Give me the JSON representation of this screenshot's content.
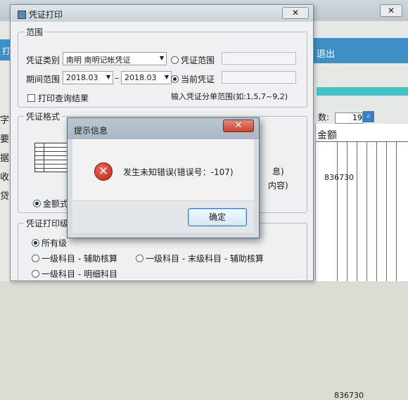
{
  "background": {
    "close_label": "✕",
    "exit_label": "退出",
    "left_tab_char": "打",
    "left_chars": [
      "字",
      "要",
      "据",
      "收",
      "贷"
    ],
    "page_label": "数:",
    "page_value": "19",
    "ledger_header": "金额",
    "ledger_values": [
      "836730",
      "836730"
    ]
  },
  "voucher_dialog": {
    "title": "凭证打印",
    "close_label": "✕",
    "range_group": {
      "legend": "范围",
      "voucher_type_label": "凭证类别",
      "voucher_type_value": "南明 南明记帐凭证",
      "radio_voucher_range": "凭证范围",
      "period_label": "期间范围",
      "period_from": "2018.03",
      "period_to": "2018.03",
      "radio_current_voucher": "当前凭证",
      "print_query_label": "打印查询结果",
      "hint": "输入凭证分单范围(如:1,5,7~9,2)"
    },
    "format_group": {
      "legend": "凭证格式",
      "radio_full_amount": "金额式",
      "partial_right_1": "息)",
      "partial_right_2": "内容)"
    },
    "level_group": {
      "legend": "凭证打印级",
      "radio_all": "所有级",
      "radio_l1_aux": "一级科目 - 辅助核算",
      "radio_l1_last": "一级科目 - 末级科目 - 辅助核算",
      "radio_l1_detail": "一级科目 - 明细科目"
    }
  },
  "alert_dialog": {
    "title": "提示信息",
    "close_label": "✕",
    "error_icon": "error-icon",
    "message": "发生未知错误(错误号：-107)",
    "ok_label": "确定"
  }
}
